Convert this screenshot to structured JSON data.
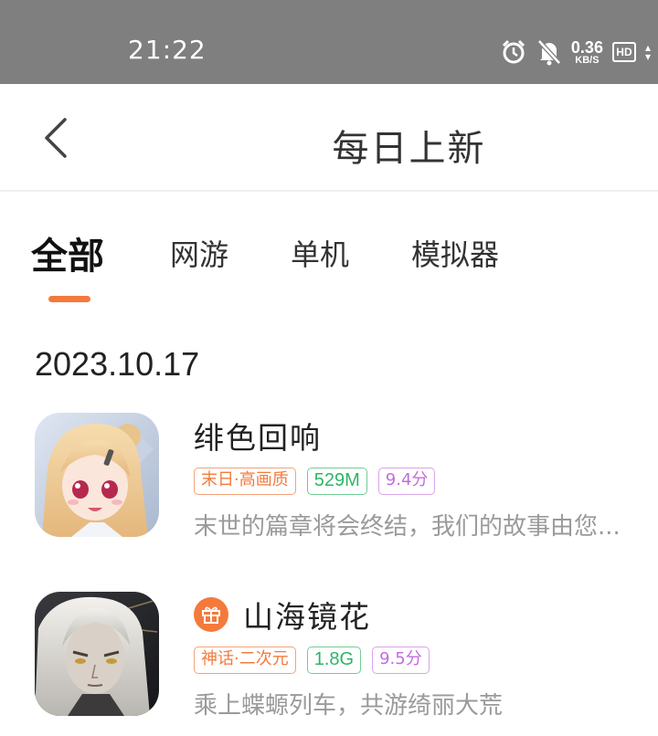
{
  "status_bar": {
    "time": "21:22",
    "net_speed_value": "0.36",
    "net_speed_unit": "KB/S",
    "hd_label": "HD",
    "icons": [
      "alarm-icon",
      "mute-bell-icon",
      "hd-icon",
      "data-arrows-icon"
    ]
  },
  "header": {
    "back_icon": "chevron-left-icon",
    "title": "每日上新"
  },
  "tabs": [
    {
      "label": "全部",
      "active": true
    },
    {
      "label": "网游",
      "active": false
    },
    {
      "label": "单机",
      "active": false
    },
    {
      "label": "模拟器",
      "active": false
    }
  ],
  "date": "2023.10.17",
  "games": [
    {
      "name": "绯色回响",
      "has_gift": false,
      "tags": [
        "末日·高画质",
        "529M",
        "9.4分"
      ],
      "desc": "末世的篇章将会终结，我们的故事由您..."
    },
    {
      "name": "山海镜花",
      "has_gift": true,
      "tags": [
        "神话·二次元",
        "1.8G",
        "9.5分"
      ],
      "desc": "乘上蝶螈列车，共游绮丽大荒"
    }
  ],
  "colors": {
    "accent": "#f47a3c",
    "status_bar": "#7f7f7f",
    "tag_green": "#2fb466",
    "tag_purple": "#c26be0",
    "desc_gray": "#9a9a9a"
  }
}
